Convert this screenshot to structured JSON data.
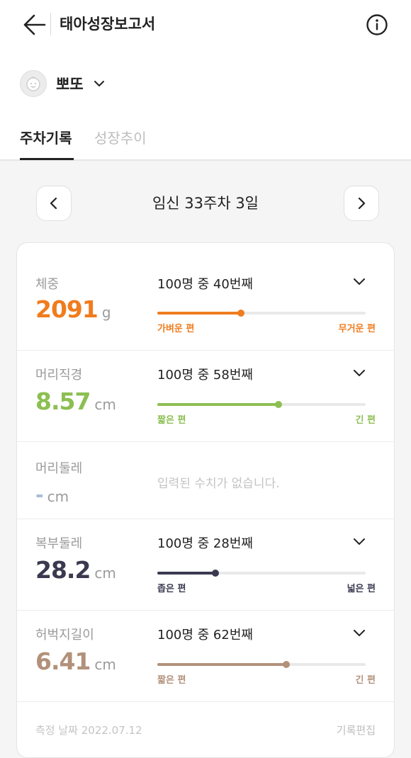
{
  "header": {
    "title": "태아성장보고서",
    "back_icon": "arrow-left-icon",
    "info_icon": "info-circle-icon"
  },
  "baby": {
    "name": "뽀또",
    "avatar_icon": "baby-face-icon"
  },
  "tabs": [
    {
      "label": "주차기록",
      "active": true
    },
    {
      "label": "성장추이",
      "active": false
    }
  ],
  "week_nav": {
    "label": "임신 33주차 3일",
    "prev_icon": "chevron-left-icon",
    "next_icon": "chevron-right-icon"
  },
  "measurements": [
    {
      "label": "체중",
      "value": "2091",
      "unit": "g",
      "rank": "100명 중 40번째",
      "percentile": 40,
      "low_label": "가벼운 편",
      "high_label": "무거운 편",
      "color": "#f07c1e"
    },
    {
      "label": "머리직경",
      "value": "8.57",
      "unit": "cm",
      "rank": "100명 중 58번째",
      "percentile": 58,
      "low_label": "짧은 편",
      "high_label": "긴 편",
      "color": "#8cbf52"
    },
    {
      "label": "머리둘레",
      "value": "-",
      "unit": "cm",
      "empty_message": "입력된 수치가 없습니다.",
      "color": "#a8bdd6"
    },
    {
      "label": "복부둘레",
      "value": "28.2",
      "unit": "cm",
      "rank": "100명 중 28번째",
      "percentile": 28,
      "low_label": "좁은 편",
      "high_label": "넓은 편",
      "color": "#3a3950"
    },
    {
      "label": "허벅지길이",
      "value": "6.41",
      "unit": "cm",
      "rank": "100명 중 62번째",
      "percentile": 62,
      "low_label": "짧은 편",
      "high_label": "긴 편",
      "color": "#b2917a"
    }
  ],
  "footer": {
    "date": "측정 날짜 2022.07.12",
    "edit_label": "기록편집"
  }
}
